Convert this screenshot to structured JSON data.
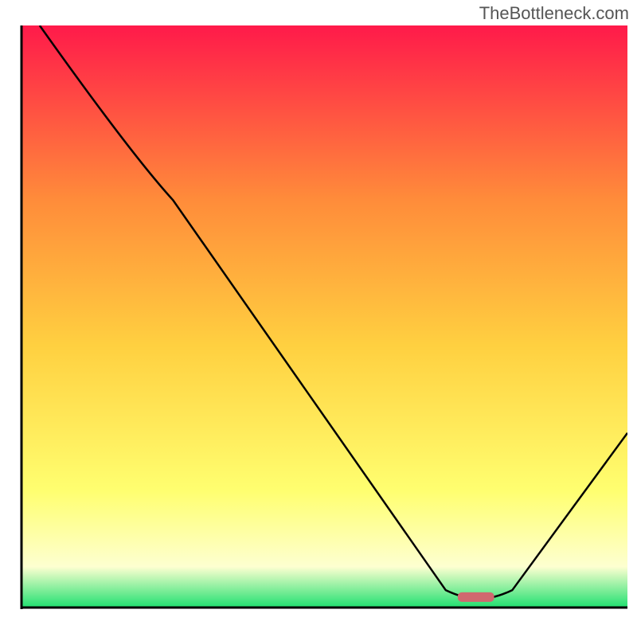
{
  "watermark": "TheBottleneck.com",
  "chart_data": {
    "type": "line",
    "title": "",
    "xlabel": "",
    "ylabel": "",
    "xlim": [
      0,
      100
    ],
    "ylim": [
      0,
      100
    ],
    "background_gradient": {
      "top": "#ff1a4a",
      "mid_upper": "#ff8c3a",
      "mid": "#ffd040",
      "mid_lower": "#ffff70",
      "lower": "#fdffd0",
      "bottom": "#20e070"
    },
    "curve": {
      "name": "bottleneck-curve",
      "color": "#000000",
      "points": [
        {
          "x": 3,
          "y": 100
        },
        {
          "x": 18,
          "y": 78
        },
        {
          "x": 25,
          "y": 70
        },
        {
          "x": 70,
          "y": 3
        },
        {
          "x": 73,
          "y": 1.5
        },
        {
          "x": 78,
          "y": 1.5
        },
        {
          "x": 81,
          "y": 3
        },
        {
          "x": 100,
          "y": 30
        }
      ]
    },
    "marker": {
      "x": 75,
      "y": 1.8,
      "width": 6,
      "color": "#d0686f"
    },
    "axes": {
      "color": "#000000",
      "width": 3
    }
  }
}
